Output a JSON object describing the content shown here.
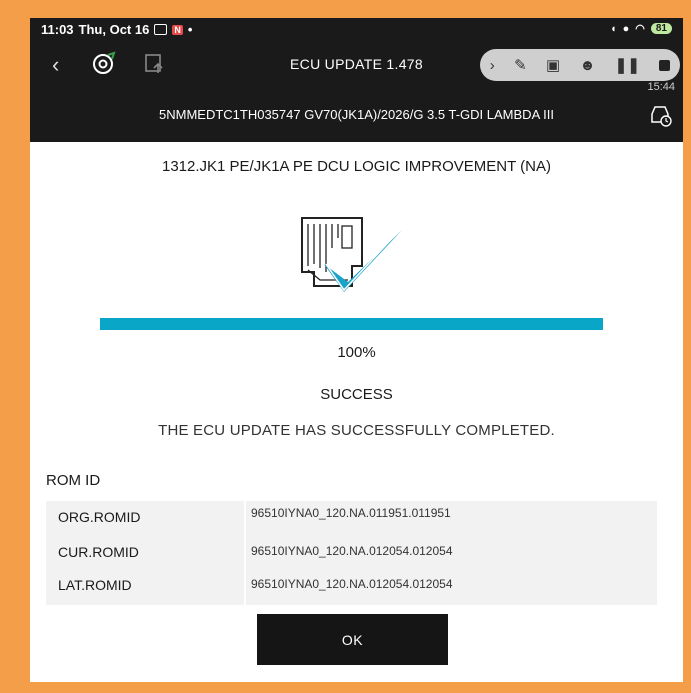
{
  "status_bar": {
    "time": "11:03",
    "date": "Thu, Oct 16",
    "notif_badge": "N",
    "battery": "81"
  },
  "toolbar": {
    "title": "ECU UPDATE 1.478",
    "recording_time": "15:44"
  },
  "vehicle": {
    "info": "5NMMEDTC1TH035747  GV70(JK1A)/2026/G 3.5 T-GDI LAMBDA III"
  },
  "update": {
    "headline": "1312.JK1 PE/JK1A PE DCU LOGIC IMPROVEMENT (NA)",
    "progress_percent": 100,
    "progress_label": "100%",
    "status": "SUCCESS",
    "message": "THE ECU UPDATE HAS SUCCESSFULLY COMPLETED."
  },
  "rom": {
    "label": "ROM ID",
    "rows": [
      {
        "key": "ORG.ROMID",
        "value": "96510IYNA0_120.NA.011951.011951"
      },
      {
        "key": "CUR.ROMID",
        "value": "96510IYNA0_120.NA.012054.012054"
      },
      {
        "key": "LAT.ROMID",
        "value": "96510IYNA0_120.NA.012054.012054"
      }
    ]
  },
  "actions": {
    "ok_label": "OK"
  },
  "colors": {
    "frame": "#f59e4a",
    "header_bg": "#1a1a1a",
    "progress": "#0aa6c8",
    "check": "#1aa3c8"
  }
}
